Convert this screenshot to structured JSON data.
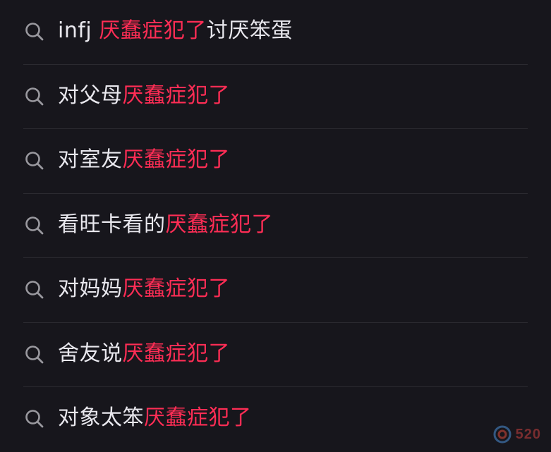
{
  "colors": {
    "background": "#17161c",
    "text": "#e9e8ee",
    "highlight": "#ff2d55",
    "icon": "#9a999f",
    "divider": "#2b2a30"
  },
  "search_suggestions": [
    {
      "pre": "infj ",
      "highlight": "厌蠢症犯了",
      "post": "讨厌笨蛋",
      "icon": "search-icon"
    },
    {
      "pre": "对父母",
      "highlight": "厌蠢症犯了",
      "post": "",
      "icon": "search-icon"
    },
    {
      "pre": "对室友",
      "highlight": "厌蠢症犯了",
      "post": "",
      "icon": "search-icon"
    },
    {
      "pre": "看旺卡看的",
      "highlight": "厌蠢症犯了",
      "post": "",
      "icon": "search-icon"
    },
    {
      "pre": "对妈妈",
      "highlight": "厌蠢症犯了",
      "post": "",
      "icon": "search-icon"
    },
    {
      "pre": "舍友说",
      "highlight": "厌蠢症犯了",
      "post": "",
      "icon": "search-icon"
    },
    {
      "pre": "对象太笨",
      "highlight": "厌蠢症犯了",
      "post": "",
      "icon": "search-icon"
    }
  ],
  "watermark": {
    "text": "520"
  }
}
